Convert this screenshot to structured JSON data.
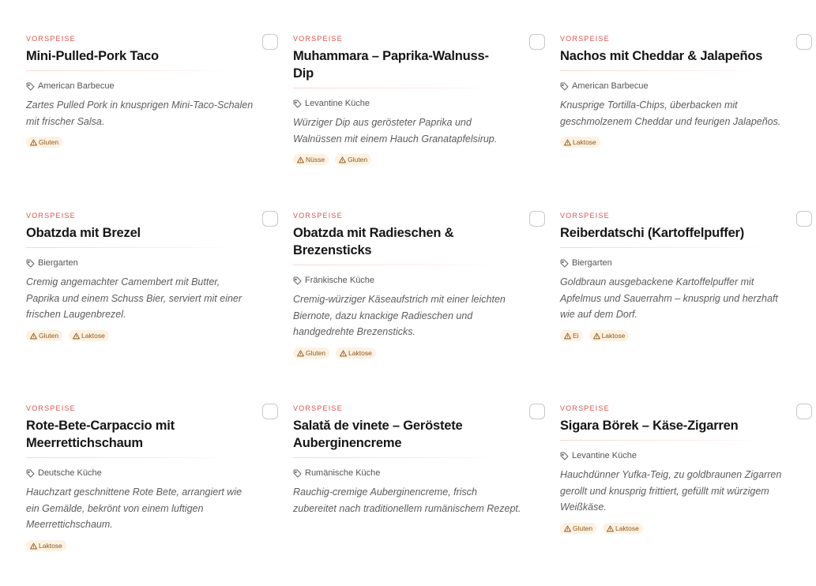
{
  "cards": [
    {
      "category": "VORSPEISE",
      "title": "Mini-Pulled-Pork Taco",
      "cuisine": "American Barbecue",
      "description": "Zartes Pulled Pork in knusprigen Mini-Taco-Schalen mit frischer Salsa.",
      "allergens": [
        "Gluten"
      ]
    },
    {
      "category": "VORSPEISE",
      "title": "Muhammara – Paprika-Walnuss-Dip",
      "cuisine": "Levantine Küche",
      "description": "Würziger Dip aus gerösteter Paprika und Walnüssen mit einem Hauch Granatapfelsirup.",
      "allergens": [
        "Nüsse",
        "Gluten"
      ]
    },
    {
      "category": "VORSPEISE",
      "title": "Nachos mit Cheddar & Jalapeños",
      "cuisine": "American Barbecue",
      "description": "Knusprige Tortilla-Chips, überbacken mit geschmolzenem Cheddar und feurigen Jalapeños.",
      "allergens": [
        "Laktose"
      ]
    },
    {
      "category": "VORSPEISE",
      "title": "Obatzda mit Brezel",
      "cuisine": "Biergarten",
      "description": "Cremig angemachter Camembert mit Butter, Paprika und einem Schuss Bier, serviert mit einer frischen Laugenbrezel.",
      "allergens": [
        "Gluten",
        "Laktose"
      ]
    },
    {
      "category": "VORSPEISE",
      "title": "Obatzda mit Radieschen & Brezensticks",
      "cuisine": "Fränkische Küche",
      "description": "Cremig-würziger Käseaufstrich mit einer leichten Biernote, dazu knackige Radieschen und handgedrehte Brezensticks.",
      "allergens": [
        "Gluten",
        "Laktose"
      ]
    },
    {
      "category": "VORSPEISE",
      "title": "Reiberdatschi (Kartoffelpuffer)",
      "cuisine": "Biergarten",
      "description": "Goldbraun ausgebackene Kartoffelpuffer mit Apfelmus und Sauerrahm – knusprig und herzhaft wie auf dem Dorf.",
      "allergens": [
        "Ei",
        "Laktose"
      ]
    },
    {
      "category": "VORSPEISE",
      "title": "Rote-Bete-Carpaccio mit Meerrettichschaum",
      "cuisine": "Deutsche Küche",
      "description": "Hauchzart geschnittene Rote Bete, arrangiert wie ein Gemälde, bekrönt von einem luftigen Meerrettichschaum.",
      "allergens": [
        "Laktose"
      ]
    },
    {
      "category": "VORSPEISE",
      "title": "Salată de vinete – Geröstete Auberginencreme",
      "cuisine": "Rumänische Küche",
      "description": "Rauchig-cremige Auberginencreme, frisch zubereitet nach traditionellem rumänischem Rezept.",
      "allergens": []
    },
    {
      "category": "VORSPEISE",
      "title": "Sigara Börek – Käse-Zigarren",
      "cuisine": "Levantine Küche",
      "description": "Hauchdünner Yufka-Teig, zu goldbraunen Zigarren gerollt und knusprig frittiert, gefüllt mit würzigem Weißkäse.",
      "allergens": [
        "Gluten",
        "Laktose"
      ]
    }
  ],
  "colors": {
    "category": "#d9534f",
    "badge_bg": "#fdf1e2",
    "badge_text": "#8a5a1e"
  },
  "icons": {
    "cuisine": "tag-icon",
    "allergen": "warning-icon",
    "select": "checkbox-icon"
  }
}
